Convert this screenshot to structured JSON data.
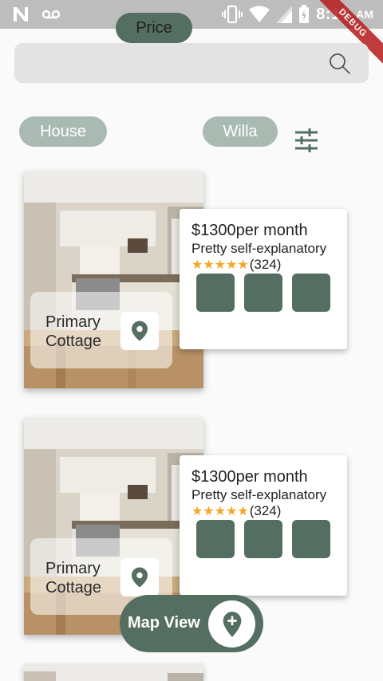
{
  "status_bar": {
    "time": "8:18",
    "ampm": "AM"
  },
  "debug_banner": "DEBUG",
  "search": {
    "value": "",
    "placeholder": ""
  },
  "filters": [
    {
      "label": "House",
      "selected": false
    },
    {
      "label": "Price",
      "selected": true
    },
    {
      "label": "Willa",
      "selected": false
    }
  ],
  "listings": [
    {
      "name": "Primary Cottage",
      "price": "$1300per month",
      "description": "Pretty self-explanatory",
      "rating_stars": "★★★★★",
      "review_count": "(324)"
    },
    {
      "name": "Primary Cottage",
      "price": "$1300per month",
      "description": "Pretty self-explanatory",
      "rating_stars": "★★★★★",
      "review_count": "(324)"
    }
  ],
  "map_view": {
    "label": "Map View"
  },
  "colors": {
    "accent": "#546e61",
    "chip_inactive": "#a9bab2",
    "star": "#f5a623"
  }
}
